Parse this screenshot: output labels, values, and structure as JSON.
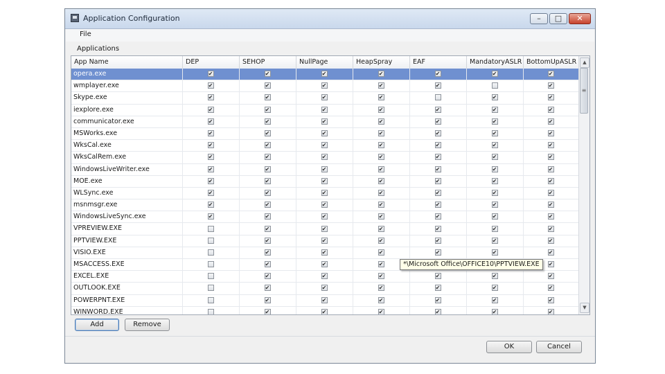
{
  "window": {
    "title": "Application Configuration"
  },
  "menu": {
    "file": "File"
  },
  "group_label": "Applications",
  "columns": [
    "App Name",
    "DEP",
    "SEHOP",
    "NullPage",
    "HeapSpray",
    "EAF",
    "MandatoryASLR",
    "BottomUpASLR"
  ],
  "rows": [
    {
      "name": "opera.exe",
      "checks": [
        true,
        true,
        true,
        true,
        true,
        true,
        true
      ],
      "selected": true
    },
    {
      "name": "wmplayer.exe",
      "checks": [
        true,
        true,
        true,
        true,
        true,
        false,
        true
      ]
    },
    {
      "name": "Skype.exe",
      "checks": [
        true,
        true,
        true,
        true,
        false,
        true,
        true
      ]
    },
    {
      "name": "iexplore.exe",
      "checks": [
        true,
        true,
        true,
        true,
        true,
        true,
        true
      ]
    },
    {
      "name": "communicator.exe",
      "checks": [
        true,
        true,
        true,
        true,
        true,
        true,
        true
      ]
    },
    {
      "name": "MSWorks.exe",
      "checks": [
        true,
        true,
        true,
        true,
        true,
        true,
        true
      ]
    },
    {
      "name": "WksCal.exe",
      "checks": [
        true,
        true,
        true,
        true,
        true,
        true,
        true
      ]
    },
    {
      "name": "WksCalRem.exe",
      "checks": [
        true,
        true,
        true,
        true,
        true,
        true,
        true
      ]
    },
    {
      "name": "WindowsLiveWriter.exe",
      "checks": [
        true,
        true,
        true,
        true,
        true,
        true,
        true
      ]
    },
    {
      "name": "MOE.exe",
      "checks": [
        true,
        true,
        true,
        true,
        true,
        true,
        true
      ]
    },
    {
      "name": "WLSync.exe",
      "checks": [
        true,
        true,
        true,
        true,
        true,
        true,
        true
      ]
    },
    {
      "name": "msnmsgr.exe",
      "checks": [
        true,
        true,
        true,
        true,
        true,
        true,
        true
      ]
    },
    {
      "name": "WindowsLiveSync.exe",
      "checks": [
        true,
        true,
        true,
        true,
        true,
        true,
        true
      ]
    },
    {
      "name": "VPREVIEW.EXE",
      "checks": [
        false,
        true,
        true,
        true,
        true,
        true,
        true
      ]
    },
    {
      "name": "PPTVIEW.EXE",
      "checks": [
        false,
        true,
        true,
        true,
        true,
        true,
        true
      ]
    },
    {
      "name": "VISIO.EXE",
      "checks": [
        false,
        true,
        true,
        true,
        true,
        true,
        true
      ]
    },
    {
      "name": "MSACCESS.EXE",
      "checks": [
        false,
        true,
        true,
        true,
        true,
        true,
        true
      ]
    },
    {
      "name": "EXCEL.EXE",
      "checks": [
        false,
        true,
        true,
        true,
        true,
        true,
        true
      ]
    },
    {
      "name": "OUTLOOK.EXE",
      "checks": [
        false,
        true,
        true,
        true,
        true,
        true,
        true
      ]
    },
    {
      "name": "POWERPNT.EXE",
      "checks": [
        false,
        true,
        true,
        true,
        true,
        true,
        true
      ]
    },
    {
      "name": "WINWORD.EXE",
      "checks": [
        false,
        true,
        true,
        true,
        true,
        true,
        true
      ]
    }
  ],
  "tooltip": "*\\Microsoft Office\\OFFICE10\\PPTVIEW.EXE",
  "buttons": {
    "add": "Add",
    "remove": "Remove",
    "ok": "OK",
    "cancel": "Cancel"
  },
  "window_controls": {
    "minimize": "–",
    "maximize": "□",
    "close": "✕"
  },
  "scrollbar": {
    "up": "▲",
    "down": "▼",
    "thumb": "≡"
  },
  "checkbox_glyph": "✔",
  "icons": {
    "app": "app-window-icon"
  }
}
